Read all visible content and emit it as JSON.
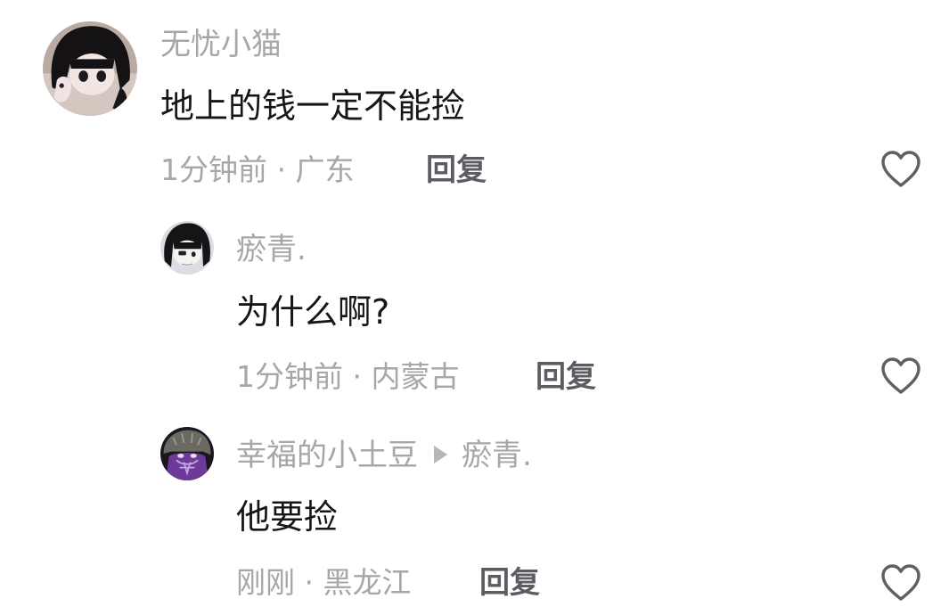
{
  "comments": [
    {
      "user": "无忧小猫",
      "text": "地上的钱一定不能捡",
      "time": "1分钟前",
      "location": "广东",
      "reply_label": "回复"
    }
  ],
  "replies": [
    {
      "user": "瘀青.",
      "text": "为什么啊?",
      "time": "1分钟前",
      "location": "内蒙古",
      "reply_label": "回复"
    },
    {
      "user": "幸福的小土豆",
      "reply_to": "瘀青.",
      "text": "他要捡",
      "time": "刚刚",
      "location": "黑龙江",
      "reply_label": "回复"
    }
  ],
  "separator": " · ",
  "icons": {
    "like": "heart-outline-icon",
    "reply_to": "triangle-right-icon"
  },
  "colors": {
    "username": "#a6a6ab",
    "content": "#16161a",
    "meta": "#a6a6ab",
    "reply_button": "#5c5c63",
    "heart": "#5f5f66"
  }
}
